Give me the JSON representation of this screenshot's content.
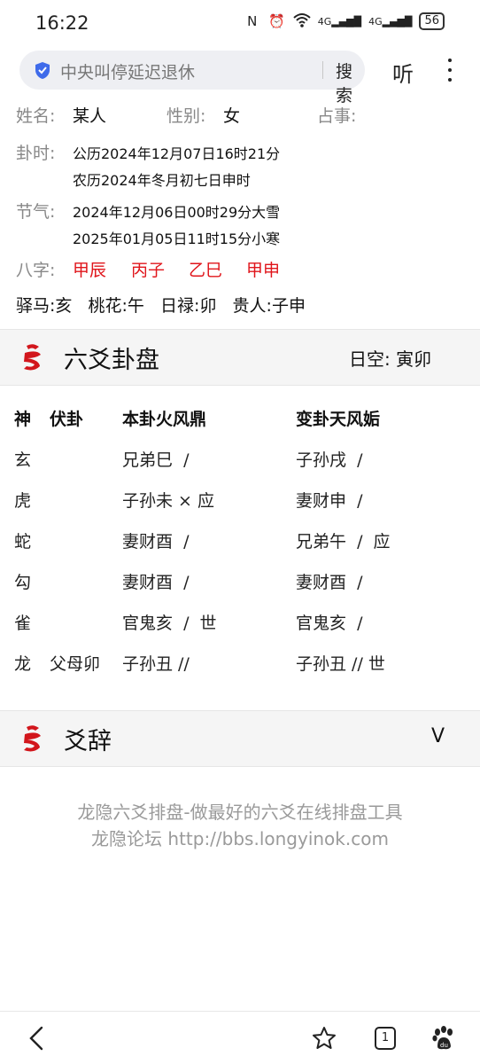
{
  "status": {
    "time": "16:22",
    "battery": "56",
    "net1": "4G",
    "net2": "4G"
  },
  "search": {
    "query": "中央叫停延迟退休",
    "button": "搜索",
    "listen": "听"
  },
  "info": {
    "name_label": "姓名:",
    "name_value": "某人",
    "gender_label": "性别:",
    "gender_value": "女",
    "matter_label": "占事:",
    "time_label": "卦时:",
    "solar": "公历2024年12月07日16时21分",
    "lunar": "农历2024年冬月初七日申时",
    "term_label": "节气:",
    "term1": "2024年12月06日00时29分大雪",
    "term2": "2025年01月05日11时15分小寒",
    "bazi_label": "八字:",
    "bazi": [
      "甲辰",
      "丙子",
      "乙巳",
      "甲申"
    ],
    "extras": "驿马:亥   桃花:午   日禄:卯   贵人:子申"
  },
  "hexagram": {
    "title": "六爻卦盘",
    "void": "日空:  寅卯",
    "headers": {
      "god": "神",
      "hidden": "伏卦",
      "main": "本卦火风鼎",
      "changed": "变卦天风姤"
    },
    "rows": [
      {
        "god": "玄",
        "hidden": "",
        "main": "兄弟巳  /",
        "changed": "子孙戌  /"
      },
      {
        "god": "虎",
        "hidden": "",
        "main": "子孙未 × 应",
        "changed": "妻财申  /"
      },
      {
        "god": "蛇",
        "hidden": "",
        "main": "妻财酉  /",
        "changed": "兄弟午  /  应"
      },
      {
        "god": "勾",
        "hidden": "",
        "main": "妻财酉  /",
        "changed": "妻财酉  /"
      },
      {
        "god": "雀",
        "hidden": "",
        "main": "官鬼亥  /  世",
        "changed": "官鬼亥  /"
      },
      {
        "god": "龙",
        "hidden": "父母卯",
        "main": "子孙丑 //",
        "changed": "子孙丑 // 世"
      }
    ]
  },
  "yaoci": {
    "title": "爻辞",
    "toggle": "V"
  },
  "footer": {
    "line1": "龙隐六爻排盘-做最好的六爻在线排盘工具",
    "line2": "龙隐论坛 http://bbs.longyinok.com"
  },
  "nav": {
    "tabs_count": "1"
  }
}
